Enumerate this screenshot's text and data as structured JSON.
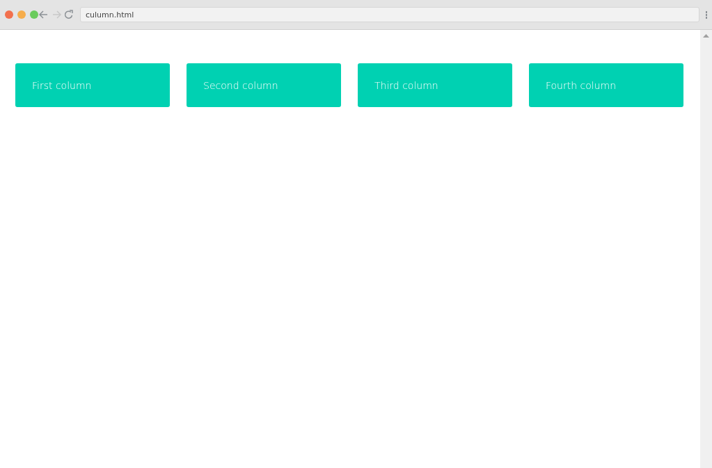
{
  "browser": {
    "nav": [
      {
        "kind": "back",
        "disabled": false
      },
      {
        "kind": "forward",
        "disabled": true
      },
      {
        "kind": "reload",
        "disabled": false
      }
    ],
    "address": "culumn.html"
  },
  "columns": [
    {
      "label": "First column"
    },
    {
      "label": "Second column"
    },
    {
      "label": "Third column"
    },
    {
      "label": "Fourth column"
    }
  ]
}
